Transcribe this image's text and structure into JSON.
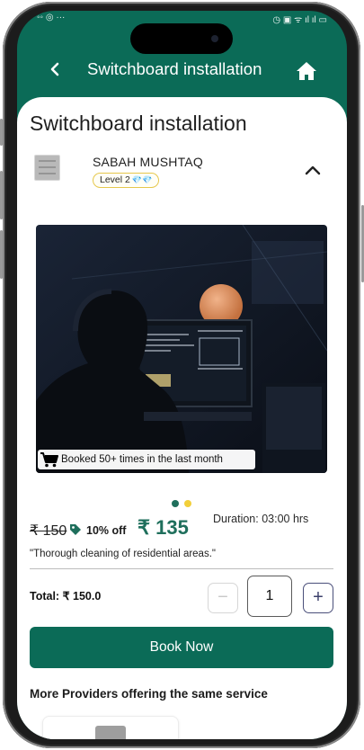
{
  "statusbar": {
    "left": "◦◦ ◎ ···",
    "right": "◷ ▣ ᯤ ıl ıl ▭"
  },
  "appbar": {
    "title": "Switchboard installation"
  },
  "page": {
    "title": "Switchboard installation"
  },
  "provider": {
    "name": "SABAH MUSHTAQ",
    "level": "Level 2",
    "level_gems": "💎💎"
  },
  "hero": {
    "booked_text": "Booked 50+ times in the last month"
  },
  "carousel": {
    "count": 2,
    "active": 0
  },
  "pricing": {
    "old_price": "₹ 150",
    "discount": "10% off",
    "price": "₹ 135",
    "duration": "Duration: 03:00 hrs",
    "description": "\"Thorough cleaning of residential areas.\""
  },
  "cart": {
    "total": "Total: ₹ 150.0",
    "minus": "−",
    "quantity": "1",
    "plus": "+"
  },
  "actions": {
    "book_now": "Book Now"
  },
  "more": {
    "heading": "More Providers offering the same service"
  },
  "colors": {
    "primary": "#0b6b57",
    "accent_dot": "#f2cf3a",
    "price": "#1f6f5c"
  },
  "icons": [
    "back-arrow-icon",
    "home-icon",
    "chevron-up-icon",
    "cart-icon",
    "tag-icon"
  ]
}
